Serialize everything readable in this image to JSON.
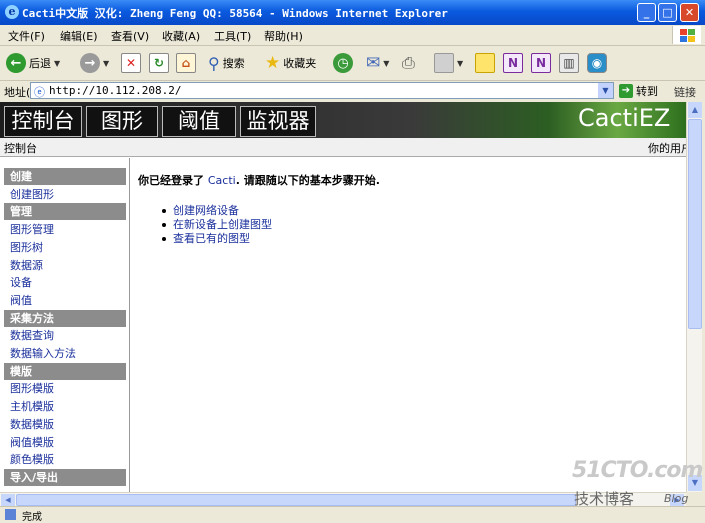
{
  "window": {
    "title": "Cacti中文版 汉化: Zheng Feng QQ: 58564 - Windows Internet Explorer",
    "icons": [
      "ie-icon",
      "minimize-icon",
      "maximize-icon",
      "close-icon"
    ]
  },
  "menubar": {
    "items": [
      "文件(F)",
      "编辑(E)",
      "查看(V)",
      "收藏(A)",
      "工具(T)",
      "帮助(H)"
    ]
  },
  "toolbar": {
    "back_label": "后退",
    "search_label": "搜索",
    "favorites_label": "收藏夹"
  },
  "addressbar": {
    "label": "地址(D)",
    "url": "http://10.112.208.2/",
    "go_label": "转到",
    "links_label": "链接"
  },
  "cacti": {
    "tabs": [
      "控制台",
      "图形",
      "阈值",
      "监视器"
    ],
    "logo": "CactiEZ",
    "breadcrumb": "控制台",
    "user_text": "你的用户",
    "sidebar": [
      {
        "type": "head",
        "label": "创建"
      },
      {
        "type": "item",
        "label": "创建图形"
      },
      {
        "type": "head",
        "label": "管理"
      },
      {
        "type": "item",
        "label": "图形管理"
      },
      {
        "type": "item",
        "label": "图形树"
      },
      {
        "type": "item",
        "label": "数据源"
      },
      {
        "type": "item",
        "label": "设备"
      },
      {
        "type": "item",
        "label": "阀值"
      },
      {
        "type": "head",
        "label": "采集方法"
      },
      {
        "type": "item",
        "label": "数据查询"
      },
      {
        "type": "item",
        "label": "数据输入方法"
      },
      {
        "type": "head",
        "label": "模版"
      },
      {
        "type": "item",
        "label": "图形模版"
      },
      {
        "type": "item",
        "label": "主机模版"
      },
      {
        "type": "item",
        "label": "数据模版"
      },
      {
        "type": "item",
        "label": "阀值模版"
      },
      {
        "type": "item",
        "label": "颜色模版"
      },
      {
        "type": "head",
        "label": "导入/导出"
      }
    ],
    "welcome_prefix": "你已经登录了",
    "welcome_brand": "Cacti",
    "welcome_suffix": ". 请跟随以下的基本步骤开始.",
    "tasks": [
      "创建网络设备",
      "在新设备上创建图型",
      "查看已有的图型"
    ]
  },
  "status": {
    "text": "完成"
  },
  "watermark": {
    "logo": "51CTO.com",
    "subtitle": "技术博客",
    "blog": "Blog"
  }
}
